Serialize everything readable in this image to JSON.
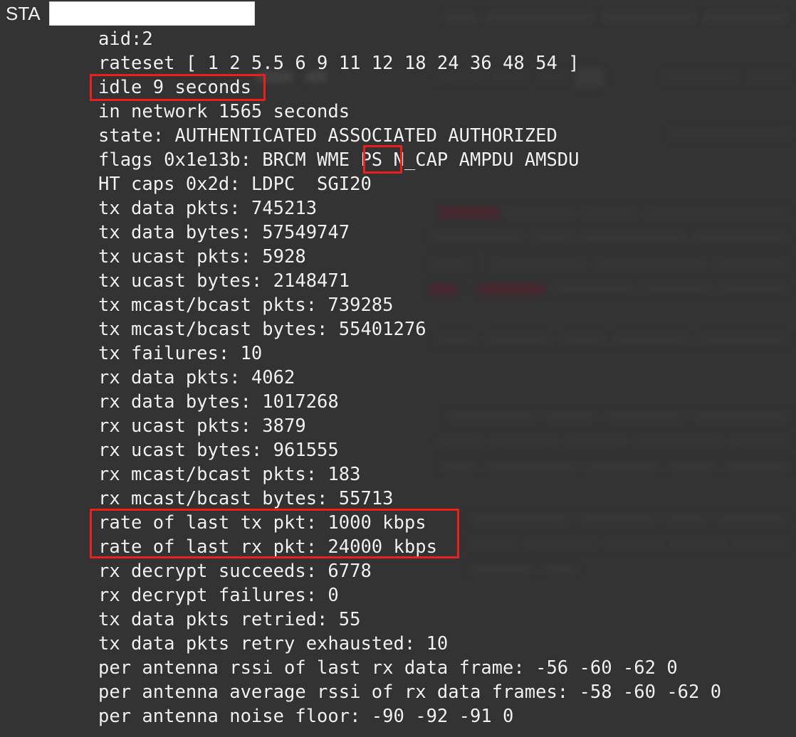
{
  "header": {
    "label": "STA",
    "redacted_value": ""
  },
  "terminal": {
    "lines": [
      "aid:2",
      "rateset [ 1 2 5.5 6 9 11 12 18 24 36 48 54 ]",
      "idle 9 seconds",
      "in network 1565 seconds",
      "state: AUTHENTICATED ASSOCIATED AUTHORIZED",
      "flags 0x1e13b: BRCM WME PS N_CAP AMPDU AMSDU",
      "HT caps 0x2d: LDPC  SGI20",
      "tx data pkts: 745213",
      "tx data bytes: 57549747",
      "tx ucast pkts: 5928",
      "tx ucast bytes: 2148471",
      "tx mcast/bcast pkts: 739285",
      "tx mcast/bcast bytes: 55401276",
      "tx failures: 10",
      "rx data pkts: 4062",
      "rx data bytes: 1017268",
      "rx ucast pkts: 3879",
      "rx ucast bytes: 961555",
      "rx mcast/bcast pkts: 183",
      "rx mcast/bcast bytes: 55713",
      "rate of last tx pkt: 1000 kbps",
      "rate of last rx pkt: 24000 kbps",
      "rx decrypt succeeds: 6778",
      "rx decrypt failures: 0",
      "tx data pkts retried: 55",
      "tx data pkts retry exhausted: 10",
      "per antenna rssi of last rx data frame: -56 -60 -62 0",
      "per antenna average rssi of rx data frames: -58 -60 -62 0",
      "per antenna noise floor: -90 -92 -91 0"
    ]
  },
  "annotations": {
    "color": "#ea2020",
    "boxes": [
      {
        "id": "anno-idle",
        "target": "idle 9 seconds"
      },
      {
        "id": "anno-ps",
        "target": "PS"
      },
      {
        "id": "anno-rates",
        "target": "rate of last tx pkt: 1000 kbps / rate of last rx pkt: 24000 kbps"
      }
    ]
  },
  "colors": {
    "background": "#333333",
    "text": "#f2f2f2",
    "annotation": "#ea2020",
    "redaction": "#ffffff"
  }
}
